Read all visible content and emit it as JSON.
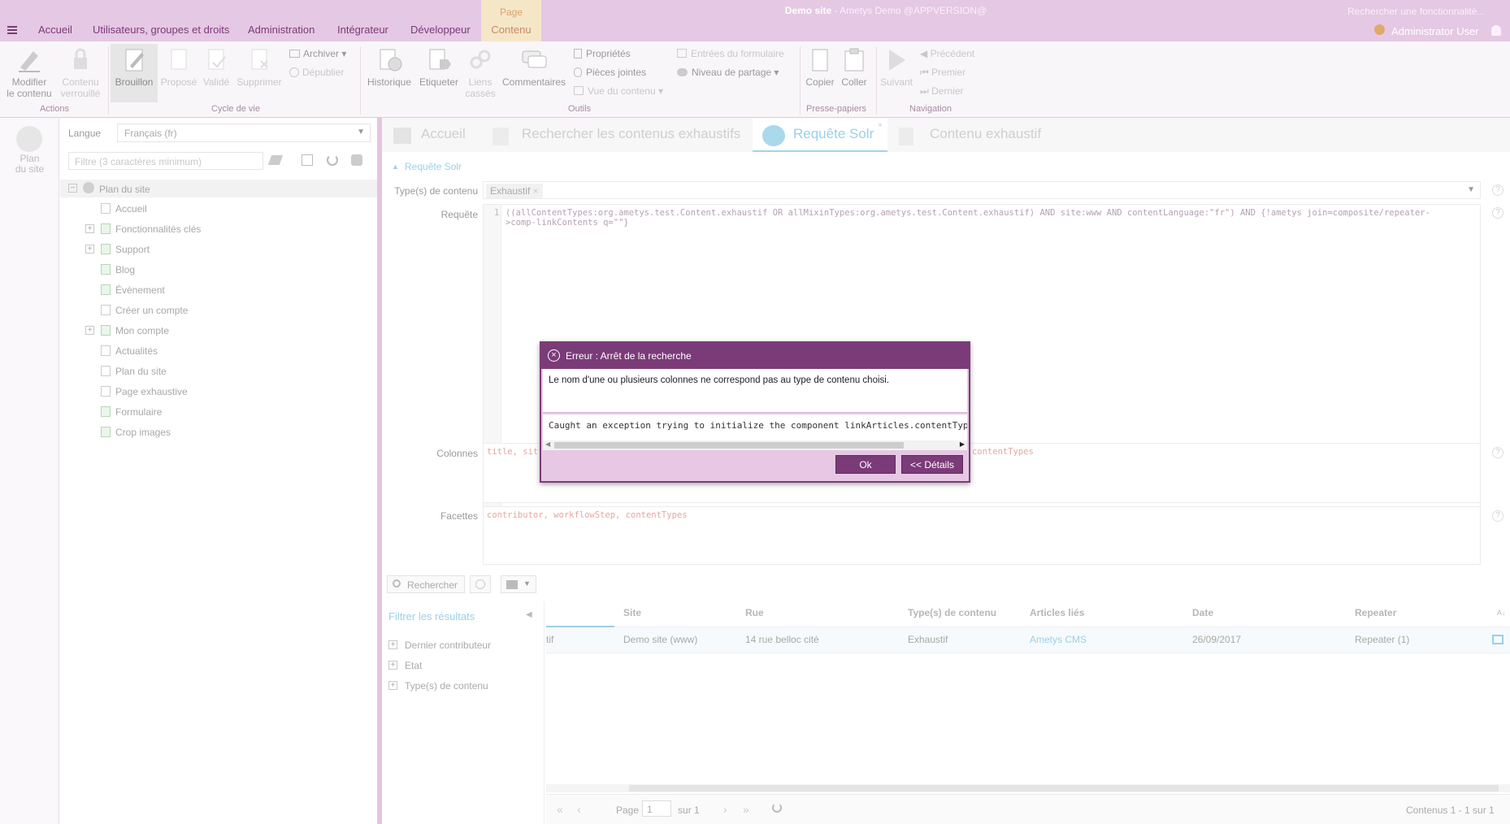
{
  "header": {
    "menu_tabs": [
      "Accueil",
      "Utilisateurs, groupes et droits",
      "Administration",
      "Intégrateur",
      "Développeur"
    ],
    "context_label": "Page",
    "context_tab": "Contenu",
    "title_site": "Demo site",
    "title_rest": " - Ametys Demo @APPVERSION@",
    "search_placeholder": "Rechercher une fonctionnalité...",
    "user": "Administrator User"
  },
  "ribbon": {
    "actions": {
      "modify": [
        "Modifier",
        "le contenu"
      ],
      "locked": [
        "Contenu",
        "verrouillé"
      ],
      "group": "Actions"
    },
    "lifecycle": {
      "draft": "Brouillon",
      "propose": "Proposé",
      "validate": "Validé",
      "delete": "Supprimer",
      "archive": "Archiver",
      "unpublish": "Dépublier",
      "group": "Cycle de vie"
    },
    "tools": {
      "history": "Historique",
      "tag": "Etiqueter",
      "broken": [
        "Liens",
        "cassés"
      ],
      "comments": "Commentaires",
      "properties": "Propriétés",
      "attachments": "Pièces jointes",
      "content_view": "Vue du contenu",
      "form_entries": "Entrées du formulaire",
      "share_level": "Niveau de partage",
      "group": "Outils"
    },
    "clipboard": {
      "copy": "Copier",
      "paste": "Coller",
      "group": "Presse-papiers"
    },
    "navigation": {
      "next": "Suivant",
      "previous": "Précédent",
      "first": "Premier",
      "last": "Dernier",
      "group": "Navigation"
    }
  },
  "leftstrip": {
    "label": [
      "Plan",
      "du site"
    ]
  },
  "tree": {
    "lang_label": "Langue",
    "lang_value": "Français (fr)",
    "filter_placeholder": "Filtre (3 caractères minimum)",
    "root": "Plan du site",
    "items": [
      "Accueil",
      "Fonctionnalités clés",
      "Support",
      "Blog",
      "Évènement",
      "Créer un compte",
      "Mon compte",
      "Actualités",
      "Plan du site",
      "Page exhaustive",
      "Formulaire",
      "Crop images"
    ]
  },
  "main": {
    "tabs": [
      "Accueil",
      "Rechercher les contenus exhaustifs",
      "Requête Solr",
      "Contenu exhaustif"
    ],
    "section_title": "Requête Solr",
    "content_type_label": "Type(s) de contenu",
    "content_type_tag": "Exhaustif",
    "query_label": "Requête",
    "query_line_no": "1",
    "query_text_1": "((allContentTypes:org.ametys.test.Content.exhaustif OR allMixinTypes:org.ametys.test.Content.exhaustif) AND site:www AND contentLanguage:\"fr\") AND {!ametys join=composite/repeater-",
    "query_text_2": ">comp-linkContents q=\"\"}",
    "columns_label": "Colonnes",
    "columns_text_left": "title, sit",
    "columns_text_right": "es.contentTypes",
    "facets_label": "Facettes",
    "facets_text": "contributor, workflowStep, contentTypes",
    "search_button": "Rechercher",
    "filter_results": "Filtrer les résultats",
    "facet_items": [
      "Dernier contributeur",
      "Etat",
      "Type(s) de contenu"
    ],
    "grid_headers": [
      "Site",
      "Rue",
      "Type(s) de contenu",
      "Articles liés",
      "Date",
      "Repeater"
    ],
    "grid_row": {
      "first": "tif",
      "site": "Demo site (www)",
      "street": "14 rue belloc cité",
      "type": "Exhaustif",
      "linked": "Ametys CMS",
      "date": "26/09/2017",
      "repeater": "Repeater (1)"
    },
    "pager": {
      "page_label": "Page",
      "page_value": "1",
      "of": "sur 1",
      "count": "Contenus 1 - 1 sur 1"
    }
  },
  "dialog": {
    "title": "Erreur : Arrêt de la recherche",
    "message": "Le nom d'une ou plusieurs colonnes ne correspond pas au type de contenu choisi.",
    "detail": "Caught an exception trying to initialize the component linkArticles.contentTypes",
    "ok": "Ok",
    "details": "<< Détails"
  }
}
